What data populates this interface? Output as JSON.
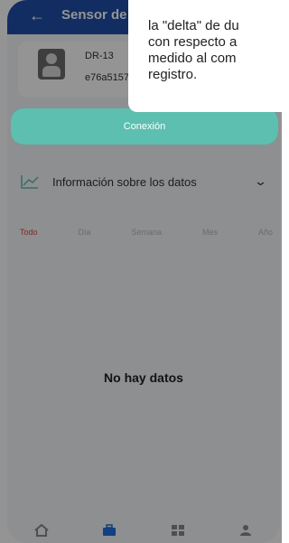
{
  "header": {
    "title": "Sensor de"
  },
  "device": {
    "name": "DR-13",
    "id": "e76a5157"
  },
  "connect": {
    "label": "Conexión"
  },
  "info": {
    "label": "Información sobre los datos"
  },
  "tabs": [
    {
      "label": "Todo"
    },
    {
      "label": "Día"
    },
    {
      "label": "Semana"
    },
    {
      "label": "Mes"
    },
    {
      "label": "Año"
    }
  ],
  "empty": {
    "message": "No hay datos"
  },
  "tooltip": {
    "lines": [
      "la \"delta\" de du",
      "con respecto a",
      "medido al com",
      "registro."
    ]
  },
  "colors": {
    "header": "#1f4fa8",
    "accent": "#5dbfb0",
    "active_tab": "#e04a3a",
    "nav_active": "#1f6fe0"
  }
}
